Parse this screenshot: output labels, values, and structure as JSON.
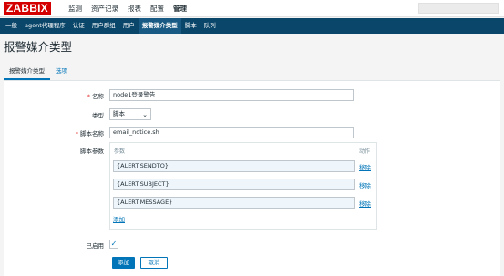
{
  "app": {
    "logo": "ZABBIX"
  },
  "top_menu": [
    {
      "label": "监测"
    },
    {
      "label": "资产记录"
    },
    {
      "label": "报表"
    },
    {
      "label": "配置"
    },
    {
      "label": "管理",
      "active": true
    }
  ],
  "sub_menu": [
    {
      "label": "一般"
    },
    {
      "label": "agent代理程序"
    },
    {
      "label": "认证"
    },
    {
      "label": "用户群组"
    },
    {
      "label": "用户"
    },
    {
      "label": "报警媒介类型",
      "active": true
    },
    {
      "label": "脚本"
    },
    {
      "label": "队列"
    }
  ],
  "page_title": "报警媒介类型",
  "tabs": [
    {
      "label": "报警媒介类型",
      "active": true
    },
    {
      "label": "选项"
    }
  ],
  "form": {
    "name": {
      "label": "名称",
      "required": true,
      "value": "node1登录警告"
    },
    "type": {
      "label": "类型",
      "value": "脚本"
    },
    "script_name": {
      "label": "脚本名称",
      "required": true,
      "value": "email_notice.sh"
    },
    "script_params": {
      "label": "脚本参数",
      "col_param": "参数",
      "col_action": "动作",
      "rows": [
        {
          "value": "{ALERT.SENDTO}",
          "action": "移除"
        },
        {
          "value": "{ALERT.SUBJECT}",
          "action": "移除"
        },
        {
          "value": "{ALERT.MESSAGE}",
          "action": "移除"
        }
      ],
      "add_label": "添加"
    },
    "enabled": {
      "label": "已启用",
      "checked": true,
      "check_glyph": "✓"
    }
  },
  "buttons": {
    "add": "添加",
    "cancel": "取消"
  },
  "icons": {
    "select_arrow": "⌄"
  },
  "colors": {
    "brand": "#d40000",
    "nav": "#0a466a",
    "accent": "#0275b8"
  }
}
